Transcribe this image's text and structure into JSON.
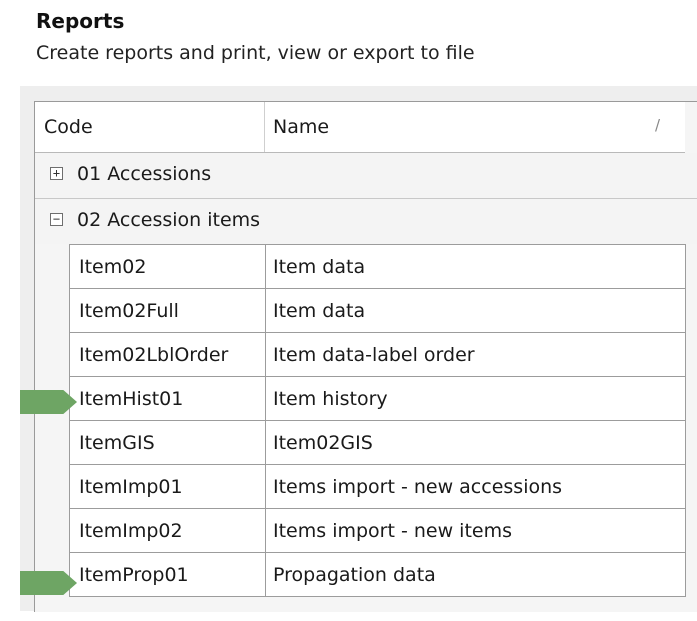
{
  "header": {
    "title": "Reports",
    "subtitle": "Create reports and print, view or export to file"
  },
  "grid": {
    "columns": {
      "code": "Code",
      "name": "Name",
      "sort_glyph": "/"
    },
    "groups": [
      {
        "label": "01 Accessions",
        "toggle": "+",
        "expanded": false
      },
      {
        "label": "02 Accession items",
        "toggle": "−",
        "expanded": true
      }
    ],
    "rows": [
      {
        "code": "Item02",
        "name": "Item data"
      },
      {
        "code": "Item02Full",
        "name": "Item data"
      },
      {
        "code": "Item02LblOrder",
        "name": "Item data-label order"
      },
      {
        "code": "ItemHist01",
        "name": "Item history"
      },
      {
        "code": "ItemGIS",
        "name": "Item02GIS"
      },
      {
        "code": "ItemImp01",
        "name": "Items import - new accessions"
      },
      {
        "code": "ItemImp02",
        "name": "Items import - new items"
      },
      {
        "code": "ItemProp01",
        "name": "Propagation data"
      }
    ]
  },
  "annotations": {
    "arrow_color": "#6ea564",
    "highlighted_rows": [
      "ItemHist01",
      "ItemProp01"
    ]
  }
}
